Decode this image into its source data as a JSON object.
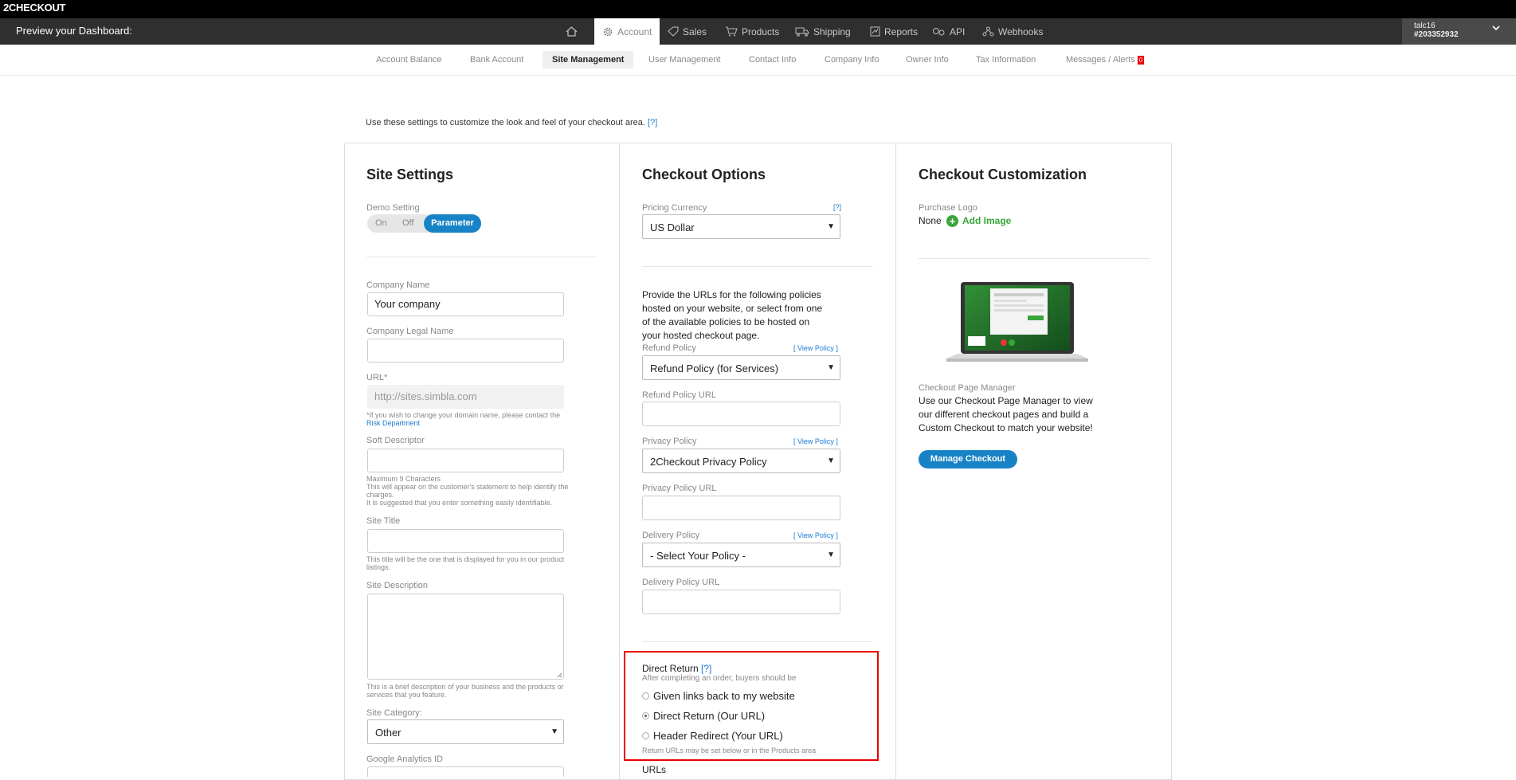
{
  "brand": "2CHECKOUT",
  "header": {
    "preview_label": "Preview your Dashboard:"
  },
  "nav": {
    "account": "Account",
    "sales": "Sales",
    "products": "Products",
    "shipping": "Shipping",
    "reports": "Reports",
    "api": "API",
    "webhooks": "Webhooks"
  },
  "user": {
    "name": "talc16",
    "id": "#203352932"
  },
  "subnav": {
    "account_balance": "Account Balance",
    "bank_account": "Bank Account",
    "site_management": "Site Management",
    "user_management": "User Management",
    "contact_info": "Contact Info",
    "company_info": "Company Info",
    "owner_info": "Owner Info",
    "tax_information": "Tax Information",
    "messages_alerts": "Messages / Alerts",
    "alerts_count": "0"
  },
  "intro": {
    "text": "Use these settings to customize the look and feel of your checkout area.",
    "help": "[?]"
  },
  "site_settings": {
    "title": "Site Settings",
    "demo_label": "Demo Setting",
    "demo_on": "On",
    "demo_off": "Off",
    "demo_param": "Parameter",
    "company_name_label": "Company Name",
    "company_name_value": "Your company",
    "legal_name_label": "Company Legal Name",
    "url_label": "URL*",
    "url_value": "http://sites.simbla.com",
    "url_note": "*If you wish to change your domain name, please contact the",
    "risk_link": "Risk Department",
    "soft_desc_label": "Soft Descriptor",
    "soft_desc_note1": "Maximum 9 Characters",
    "soft_desc_note2": "This will appear on the customer's statement to help identify the",
    "soft_desc_note3": "charges.",
    "soft_desc_note4": "It is suggested that you enter something easily identifiable.",
    "site_title_label": "Site Title",
    "site_title_note1": "This title will be the one that is displayed for you in our product",
    "site_title_note2": "listings.",
    "site_desc_label": "Site Description",
    "site_desc_note1": "This is a brief description of your business and the products or",
    "site_desc_note2": "services that you feature.",
    "site_category_label": "Site Category:",
    "site_category_value": "Other",
    "ga_label": "Google Analytics ID"
  },
  "checkout_options": {
    "title": "Checkout Options",
    "currency_label": "Pricing Currency",
    "currency_help": "[?]",
    "currency_value": "US Dollar",
    "policy_intro_1": "Provide the URLs for the following policies",
    "policy_intro_2": "hosted on your website, or select from one",
    "policy_intro_3": "of the available policies to be hosted on",
    "policy_intro_4": "your hosted checkout page.",
    "view_policy": "[ View Policy ]",
    "refund_label": "Refund Policy",
    "refund_value": "Refund Policy (for Services)",
    "refund_url_label": "Refund Policy URL",
    "privacy_label": "Privacy Policy",
    "privacy_value": "2Checkout Privacy Policy",
    "privacy_url_label": "Privacy Policy URL",
    "delivery_label": "Delivery Policy",
    "delivery_value": "- Select Your Policy -",
    "delivery_url_label": "Delivery Policy URL",
    "direct_return_label": "Direct Return",
    "direct_return_help": "[?]",
    "direct_return_sub": "After completing an order, buyers should be",
    "radio_1": "Given links back to my website",
    "radio_2": "Direct Return (Our URL)",
    "radio_3": "Header Redirect (Your URL)",
    "return_note": "Return URLs may be set below or in the Products area",
    "urls_label": "URLs"
  },
  "checkout_custom": {
    "title": "Checkout Customization",
    "logo_label": "Purchase Logo",
    "logo_value": "None",
    "add_image": "Add Image",
    "manager_label": "Checkout Page Manager",
    "manager_desc_1": "Use our Checkout Page Manager to view",
    "manager_desc_2": "our different checkout pages and build a",
    "manager_desc_3": "Custom Checkout to match your website!",
    "manage_button": "Manage Checkout"
  }
}
